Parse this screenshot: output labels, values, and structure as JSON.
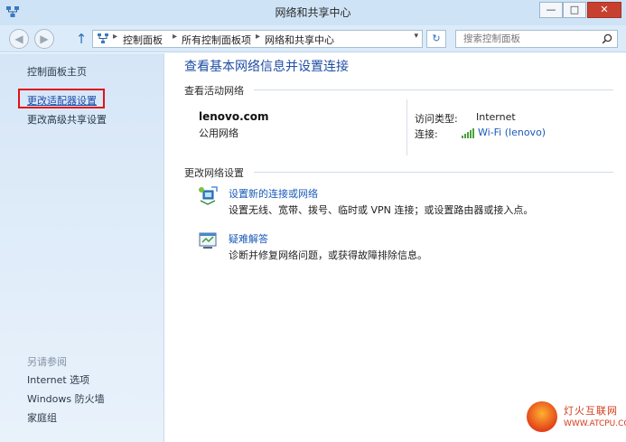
{
  "window": {
    "title": "网络和共享中心",
    "minimize_glyph": "—",
    "maximize_glyph": "□",
    "close_glyph": "✕"
  },
  "nav": {
    "back_glyph": "◀",
    "forward_glyph": "▶",
    "up_glyph": "↑",
    "breadcrumbs": [
      "控制面板",
      "所有控制面板项",
      "网络和共享中心"
    ],
    "breadcrumb_separator": "▸",
    "dropdown_glyph": "▾",
    "refresh_glyph": "↻",
    "search_placeholder": "搜索控制面板"
  },
  "sidebar": {
    "items": [
      {
        "label": "控制面板主页"
      },
      {
        "label": "更改适配器设置",
        "highlighted": true
      },
      {
        "label": "更改高级共享设置"
      }
    ],
    "see_also_title": "另请参阅",
    "see_also": [
      {
        "label": "Internet 选项"
      },
      {
        "label": "Windows 防火墙"
      },
      {
        "label": "家庭组"
      }
    ]
  },
  "main": {
    "title": "查看基本网络信息并设置连接",
    "active_networks_label": "查看活动网络",
    "network": {
      "name": "lenovo.com",
      "type": "公用网络",
      "access_type_label": "访问类型:",
      "access_type_value": "Internet",
      "connection_label": "连接:",
      "connection_value": "Wi-Fi (lenovo)"
    },
    "change_settings_label": "更改网络设置",
    "tasks": [
      {
        "link": "设置新的连接或网络",
        "desc": "设置无线、宽带、拨号、临时或 VPN 连接；或设置路由器或接入点。",
        "icon": "new-connection-icon"
      },
      {
        "link": "疑难解答",
        "desc": "诊断并修复网络问题，或获得故障排除信息。",
        "icon": "troubleshoot-icon"
      }
    ]
  },
  "watermark": {
    "name": "灯火互联网",
    "url": "WWW.ATCPU.COM"
  },
  "colors": {
    "link": "#1a5bb8",
    "title": "#1f4ea5",
    "highlight_box": "#e0121b",
    "close_button": "#c7402f"
  }
}
